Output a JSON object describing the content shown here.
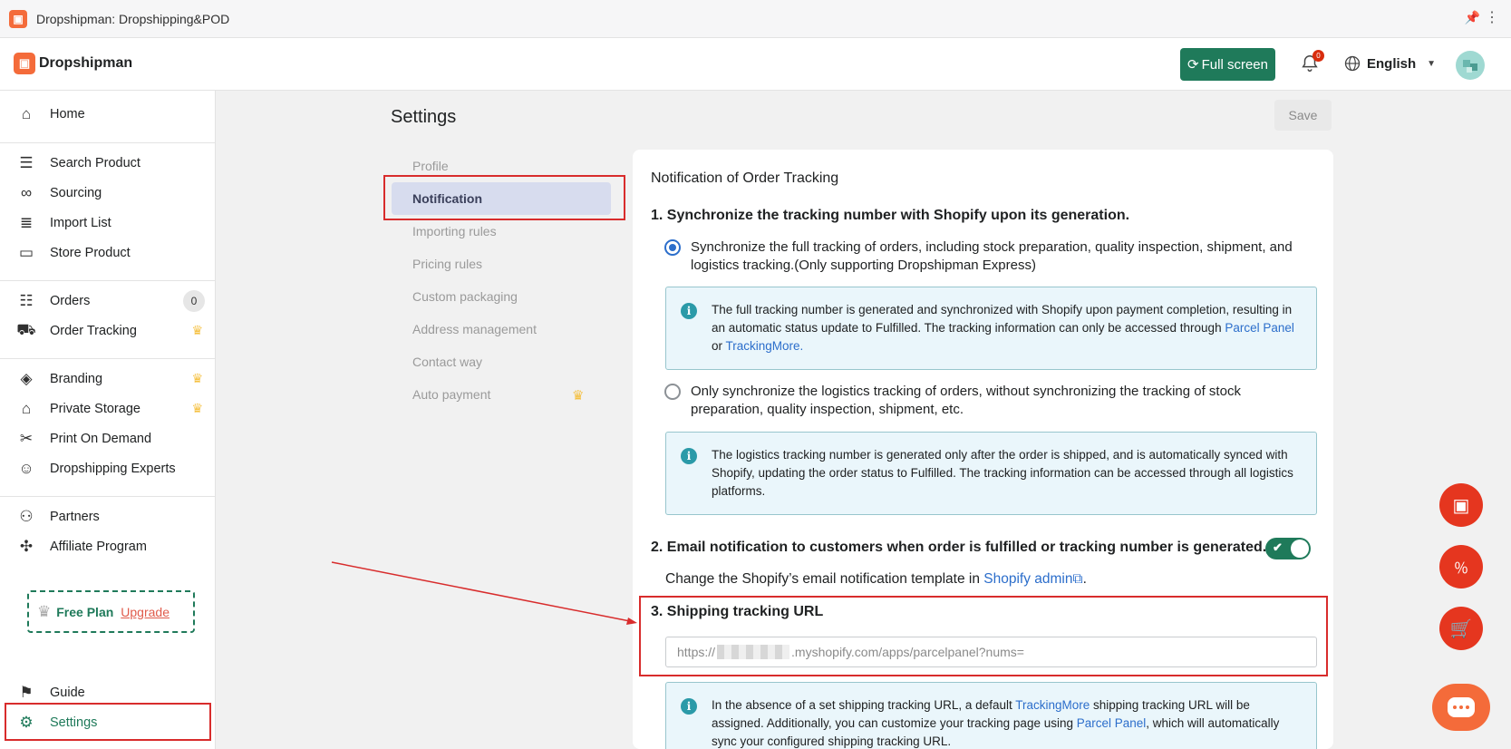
{
  "window": {
    "title": "Dropshipman: Dropshipping&POD"
  },
  "header": {
    "brand": "Dropshipman",
    "fullscreen_label": "Full screen",
    "notification_count": "0",
    "language": "English"
  },
  "sidebar": {
    "items": [
      {
        "label": "Home",
        "icon": "home-icon"
      },
      {
        "label": "Search Product",
        "icon": "search-list-icon"
      },
      {
        "label": "Sourcing",
        "icon": "glasses-icon"
      },
      {
        "label": "Import List",
        "icon": "list-icon"
      },
      {
        "label": "Store Product",
        "icon": "store-icon"
      },
      {
        "label": "Orders",
        "icon": "orders-icon",
        "count": "0"
      },
      {
        "label": "Order Tracking",
        "icon": "truck-icon",
        "premium": true
      },
      {
        "label": "Branding",
        "icon": "tag-icon",
        "premium": true
      },
      {
        "label": "Private Storage",
        "icon": "warehouse-icon",
        "premium": true
      },
      {
        "label": "Print On Demand",
        "icon": "tools-icon"
      },
      {
        "label": "Dropshipping Experts",
        "icon": "person-icon"
      },
      {
        "label": "Partners",
        "icon": "partners-icon"
      },
      {
        "label": "Affiliate Program",
        "icon": "network-icon"
      },
      {
        "label": "Guide",
        "icon": "signpost-icon"
      },
      {
        "label": "Settings",
        "icon": "gear-icon"
      }
    ],
    "plan": {
      "name": "Free Plan",
      "upgrade": "Upgrade"
    }
  },
  "settings": {
    "title": "Settings",
    "save_label": "Save",
    "menu": [
      "Profile",
      "Notification",
      "Importing rules",
      "Pricing rules",
      "Custom packaging",
      "Address management",
      "Contact way",
      "Auto payment"
    ],
    "active_menu": "Notification"
  },
  "card": {
    "title": "Notification of Order Tracking",
    "section1": {
      "heading": "1. Synchronize the tracking number with Shopify upon its generation.",
      "option1": "Synchronize the full tracking of orders, including stock preparation, quality inspection, shipment, and logistics tracking.(Only supporting Dropshipman Express)",
      "option1_selected": true,
      "info1_pre": "The full tracking number is generated and synchronized with Shopify upon payment completion, resulting in an automatic status update to Fulfilled. The tracking information can only be accessed through ",
      "info1_link1": "Parcel Panel",
      "info1_mid": " or ",
      "info1_link2": "TrackingMore.",
      "option2": "Only synchronize the logistics tracking of orders, without synchronizing the tracking of stock preparation, quality inspection, shipment, etc.",
      "info2": "The logistics tracking number is generated only after the order is shipped, and is automatically synced with Shopify, updating the order status to Fulfilled. The tracking information can be accessed through all logistics platforms."
    },
    "section2": {
      "heading": "2. Email notification to customers when order is fulfilled or tracking number is generated.",
      "toggle_on": true,
      "change_pre": "Change the Shopify’s email notification template in ",
      "change_link": "Shopify admin",
      "change_post": "."
    },
    "section3": {
      "heading": "3. Shipping tracking URL",
      "url_prefix": "https://",
      "url_suffix": ".myshopify.com/apps/parcelpanel?nums=",
      "info_pre": "In the absence of a set shipping tracking URL, a default ",
      "info_link1": "TrackingMore",
      "info_mid": " shipping tracking URL will be assigned. Additionally, you can customize your tracking page using ",
      "info_link2": "Parcel Panel",
      "info_post": ", which will automatically sync your configured shipping tracking URL."
    }
  },
  "colors": {
    "accent": "#1f7a5a",
    "brand": "#f46b3a",
    "highlight": "#d82c2c",
    "link": "#2c6ecb"
  }
}
